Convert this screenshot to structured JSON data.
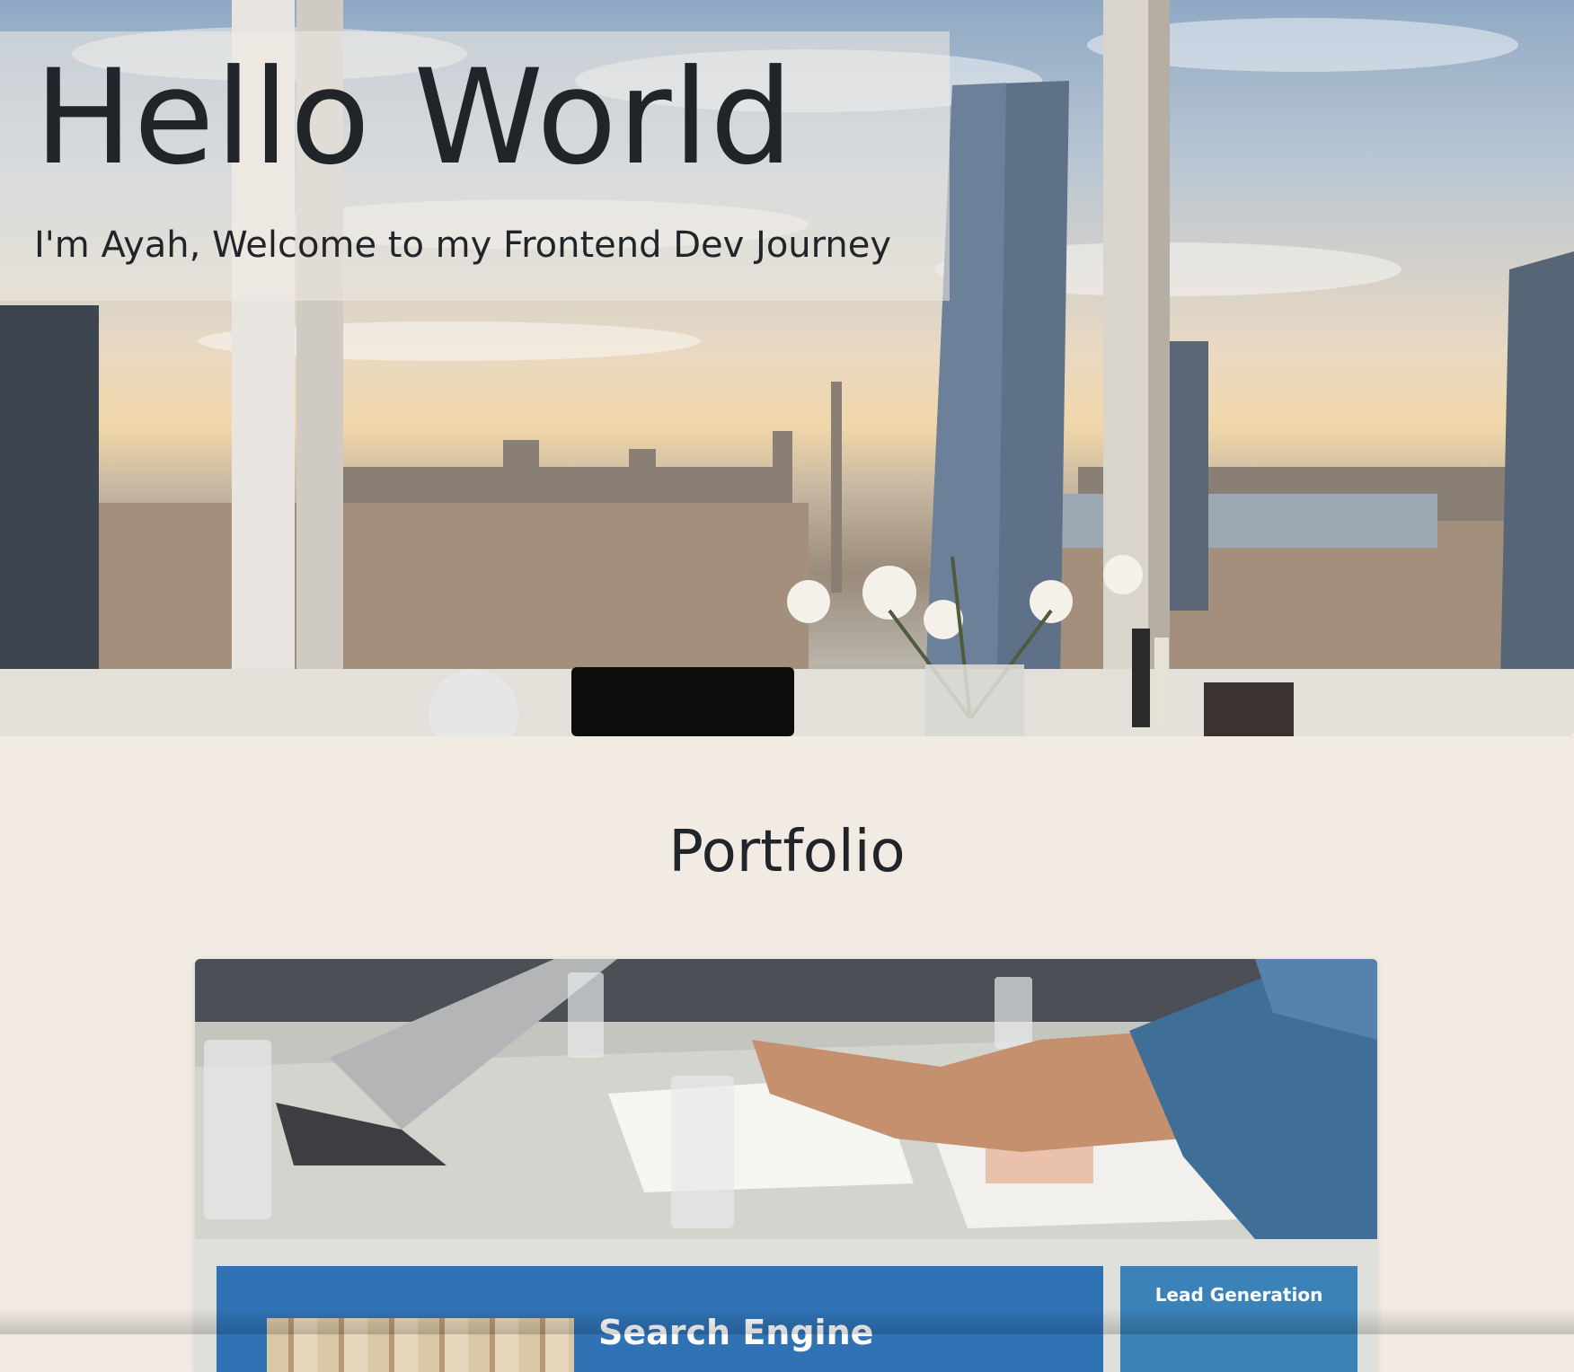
{
  "hero": {
    "title": "Hello World",
    "subtitle": "I'm Ayah, Welcome to my Frontend Dev Journey"
  },
  "portfolio": {
    "heading": "Portfolio",
    "card": {
      "thumbnail_main_title": "Search Engine",
      "thumbnail_side_label": "Lead Generation"
    }
  },
  "colors": {
    "page_background": "#f1ebe4",
    "text": "#212529",
    "thumbnail_blue": "#2f73b5",
    "thumbnail_side_blue": "#3a82b8"
  }
}
